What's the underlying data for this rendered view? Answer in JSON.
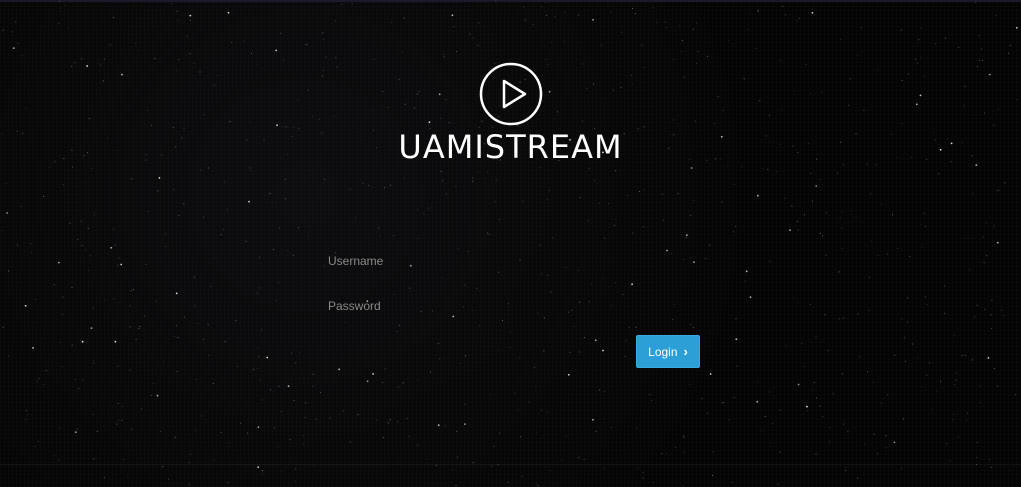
{
  "brand": {
    "name": "UAMISTREAM",
    "logo_icon": "play-circle-icon"
  },
  "form": {
    "username_placeholder": "Username",
    "password_placeholder": "Password",
    "login_label": "Login",
    "login_icon": "chevron-right-icon",
    "accent_color": "#2b9fd6"
  },
  "background": {
    "style": "starfield",
    "color": "#040404"
  }
}
